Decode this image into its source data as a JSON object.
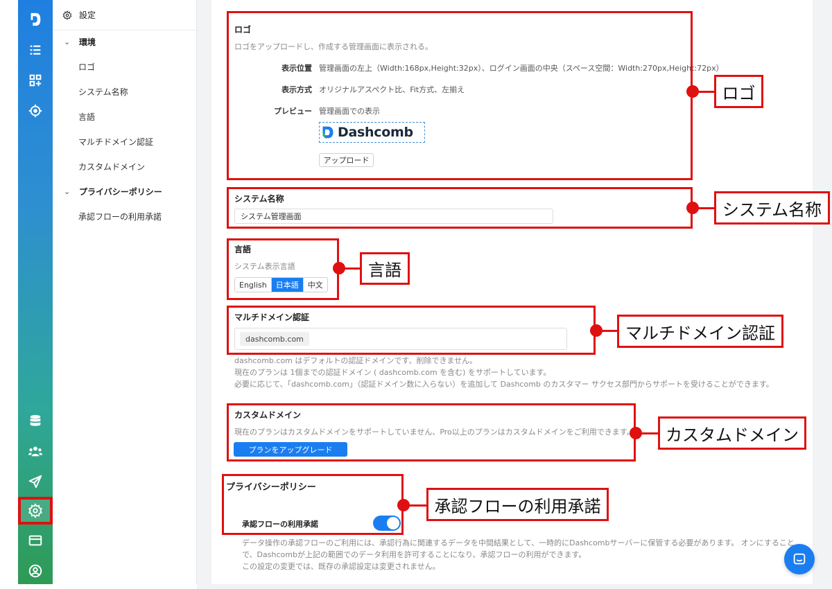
{
  "nav": {
    "header": "設定",
    "groups": [
      {
        "label": "環境",
        "items": [
          "ロゴ",
          "システム名称",
          "言語",
          "マルチドメイン認証",
          "カスタムドメイン"
        ]
      },
      {
        "label": "プライバシーポリシー",
        "items": [
          "承認フローの利用承諾"
        ]
      }
    ]
  },
  "rail": {
    "top_icons": [
      "brand-logo-icon",
      "list-icon",
      "apps-add-icon",
      "target-icon"
    ],
    "bottom_icons": [
      "database-icon",
      "users-icon",
      "send-icon",
      "gear-icon",
      "billing-card-icon",
      "account-icon"
    ],
    "active": "gear-icon"
  },
  "logo_section": {
    "title": "ロゴ",
    "description": "ロゴをアップロードし、作成する管理画面に表示される。",
    "position_label": "表示位置",
    "position_value": "管理画面の左上（Width:168px,Height:32px）、ログイン画面の中央（スペース空間：Width:270px,Height:72px）",
    "mode_label": "表示方式",
    "mode_value": "オリジナルアスペクト比、Fit方式、左揃え",
    "preview_label": "プレビュー",
    "preview_value": "管理画面での表示",
    "logo_text": "Dashcomb",
    "upload_button": "アップロード"
  },
  "system_name_section": {
    "title": "システム名称",
    "value": "システム管理画面"
  },
  "language_section": {
    "title": "言語",
    "description": "システム表示言語",
    "options": [
      "English",
      "日本語",
      "中文"
    ],
    "selected": "日本語"
  },
  "multidomain_section": {
    "title": "マルチドメイン認証",
    "tag": "dashcomb.com",
    "notes": [
      "dashcomb.com はデフォルトの認証ドメインです、削除できません。",
      "現在のプランは 1個までの認証ドメイン ( dashcomb.com を含む) をサポートしています。",
      "必要に応じて、「dashcomb.com」（認証ドメイン数に入らない）を追加して Dashcomb のカスタマー サクセス部門からサポートを受けることができます。"
    ]
  },
  "custom_domain_section": {
    "title": "カスタムドメイン",
    "description": "現在のプランはカスタムドメインをサポートしていません、Pro以上のプランはカスタムドメインをご利用できます。",
    "upgrade_button": "プランをアップグレード"
  },
  "privacy_section": {
    "title": "プライバシーポリシー",
    "toggle_label": "承認フローの利用承諾",
    "toggle_on": true,
    "notes": [
      "データ操作の承認フローのご利用には、承認行為に関連するデータを中間結果として、一時的にDashcombサーバーに保管する必要があります。 オンにすること",
      "で、Dashcombが上記の範囲でのデータ利用を許可することになり、承認フローの利用ができます。",
      "この設定の変更では、既存の承認設定は変更されません。"
    ]
  },
  "callouts": {
    "logo": "ロゴ",
    "system_name": "システム名称",
    "language": "言語",
    "multidomain": "マルチドメイン認証",
    "custom_domain": "カスタムドメイン",
    "approval": "承認フローの利用承諾"
  },
  "colors": {
    "accent": "#1a7ef0",
    "highlight": "#e01010"
  }
}
